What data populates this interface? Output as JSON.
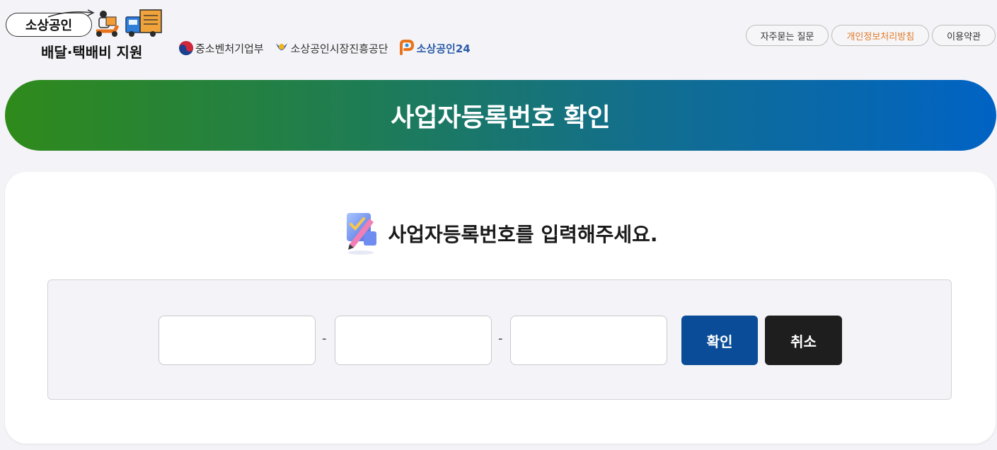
{
  "header": {
    "logo_pill_text": "소상공인",
    "logo_sub_text": "배달·택배비 지원",
    "orgs": [
      {
        "name": "중소벤처기업부",
        "icon": "taegeuk-emblem-icon"
      },
      {
        "name": "소상공인시장진흥공단",
        "icon": "semas-emblem-icon"
      },
      {
        "name": "소상공인24",
        "icon": "sbiz24-p-icon"
      }
    ],
    "links": [
      "자주묻는 질문",
      "개인정보처리방침",
      "이용약관"
    ]
  },
  "banner": {
    "title": "사업자등록번호 확인"
  },
  "card": {
    "prompt": "사업자등록번호를 입력해주세요.",
    "prompt_icon": "pencil-checklist-icon",
    "fields": [
      {
        "value": "",
        "placeholder": ""
      },
      {
        "value": "",
        "placeholder": ""
      },
      {
        "value": "",
        "placeholder": ""
      }
    ],
    "separator": "-",
    "confirm_label": "확인",
    "cancel_label": "취소"
  },
  "colors": {
    "banner_start": "#2f8a1b",
    "banner_end": "#0063c4",
    "confirm_button": "#0a4c97",
    "cancel_button": "#1e1e1e",
    "accent_link": "#e07a2a",
    "page_background": "#f4f4f8"
  }
}
